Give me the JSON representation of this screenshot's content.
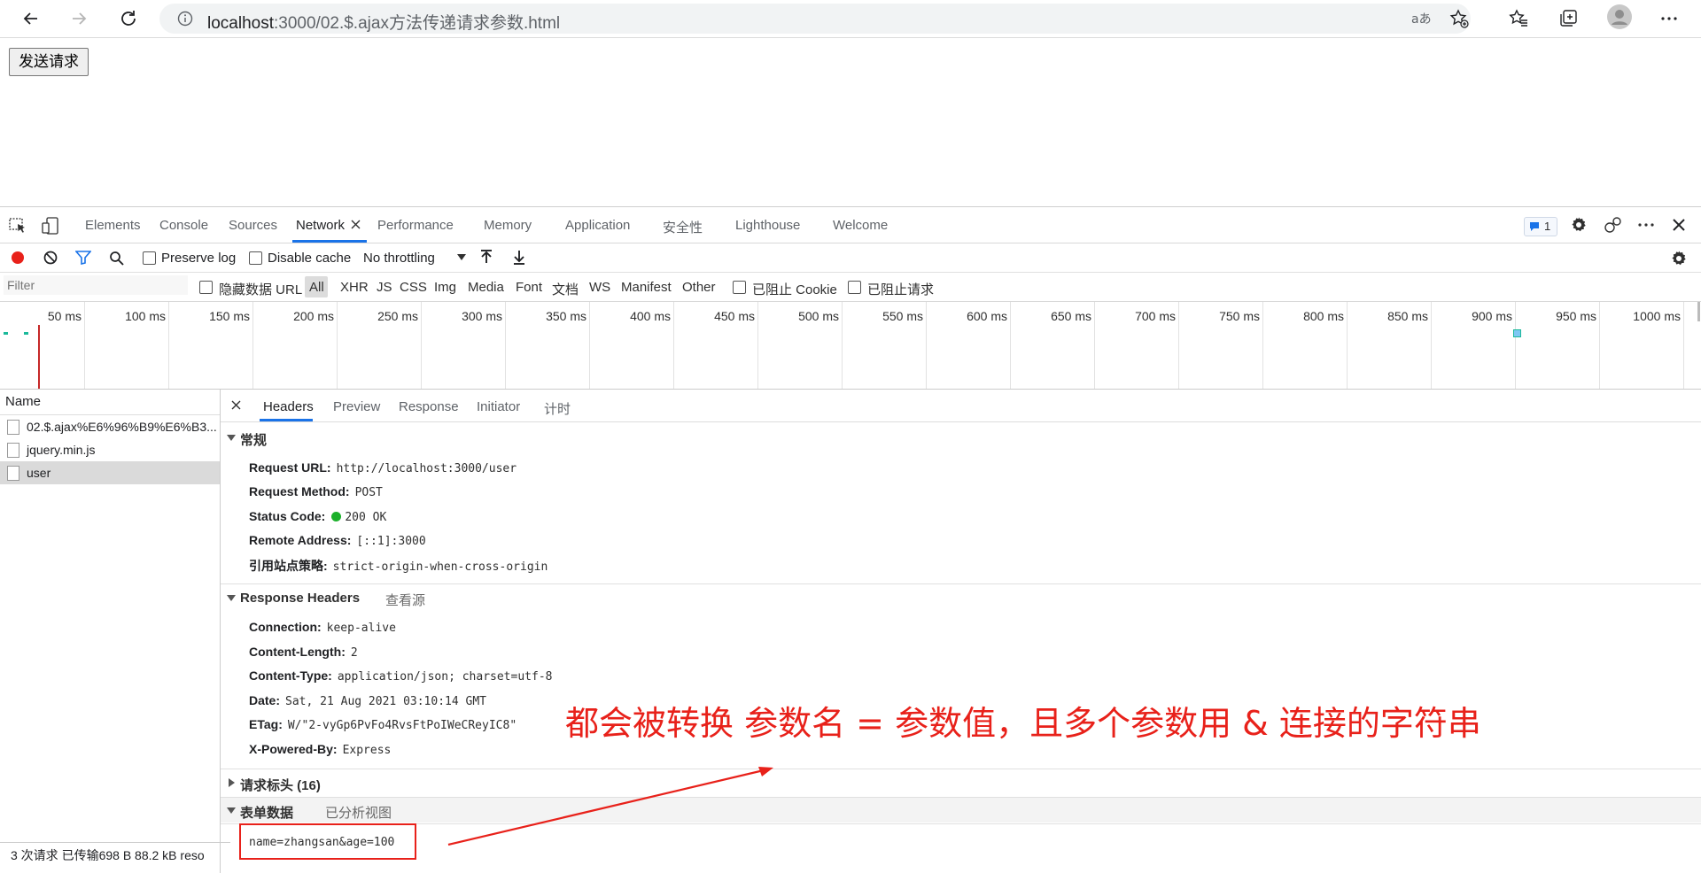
{
  "browser": {
    "url_host": "localhost",
    "url_path": ":3000/02.$.ajax方法传递请求参数.html",
    "icons": [
      "back-icon",
      "forward-icon",
      "refresh-icon",
      "info-icon",
      "read-aloud-icon",
      "favorite-add-icon",
      "favorites-icon",
      "collections-icon",
      "profile-avatar",
      "more-icon"
    ]
  },
  "page": {
    "send_button": "发送请求"
  },
  "devtools": {
    "tabs": [
      "Elements",
      "Console",
      "Sources",
      "Network",
      "Performance",
      "Memory",
      "Application",
      "安全性",
      "Lighthouse",
      "Welcome"
    ],
    "active_tab": "Network",
    "issues_badge": "1",
    "toolbar": {
      "preserve_log": "Preserve log",
      "disable_cache": "Disable cache",
      "throttling": "No throttling"
    },
    "filter": {
      "placeholder": "Filter",
      "hide_data_urls": "隐藏数据 URL",
      "types": [
        "All",
        "XHR",
        "JS",
        "CSS",
        "Img",
        "Media",
        "Font",
        "文档",
        "WS",
        "Manifest",
        "Other"
      ],
      "blocked_cookies": "已阻止 Cookie",
      "blocked_requests": "已阻止请求"
    },
    "timeline_ticks": [
      "50 ms",
      "100 ms",
      "150 ms",
      "200 ms",
      "250 ms",
      "300 ms",
      "350 ms",
      "400 ms",
      "450 ms",
      "500 ms",
      "550 ms",
      "600 ms",
      "650 ms",
      "700 ms",
      "750 ms",
      "800 ms",
      "850 ms",
      "900 ms",
      "950 ms",
      "1000 ms"
    ],
    "requests": {
      "header": "Name",
      "rows": [
        "02.$.ajax%E6%96%B9%E6%B3...",
        "jquery.min.js",
        "user"
      ],
      "selected_index": 2
    },
    "status_bar": "3 次请求   已传输698 B   88.2 kB reso",
    "detail": {
      "tabs": [
        "Headers",
        "Preview",
        "Response",
        "Initiator",
        "计时"
      ],
      "active_tab": "Headers",
      "general": {
        "title": "常规",
        "rows": [
          {
            "k": "Request URL:",
            "v": "http://localhost:3000/user"
          },
          {
            "k": "Request Method:",
            "v": "POST"
          },
          {
            "k": "Status Code:",
            "v": "200 OK"
          },
          {
            "k": "Remote Address:",
            "v": "[::1]:3000"
          },
          {
            "k": "引用站点策略:",
            "v": "strict-origin-when-cross-origin"
          }
        ]
      },
      "response_headers": {
        "title": "Response Headers",
        "view_source": "查看源",
        "rows": [
          {
            "k": "Connection:",
            "v": "keep-alive"
          },
          {
            "k": "Content-Length:",
            "v": "2"
          },
          {
            "k": "Content-Type:",
            "v": "application/json; charset=utf-8"
          },
          {
            "k": "Date:",
            "v": "Sat, 21 Aug 2021 03:10:14 GMT"
          },
          {
            "k": "ETag:",
            "v": "W/\"2-vyGp6PvFo4RvsFtPoIWeCReyIC8\""
          },
          {
            "k": "X-Powered-By:",
            "v": "Express"
          }
        ]
      },
      "request_headers": {
        "title": "请求标头 (16)"
      },
      "form_data": {
        "title": "表单数据",
        "parsed_view": "已分析视图",
        "value": "name=zhangsan&age=100"
      }
    }
  },
  "annotation": {
    "text": "都会被转换 参数名 = 参数值，且多个参数用 & 连接的字符串",
    "color": "#e8211a"
  }
}
